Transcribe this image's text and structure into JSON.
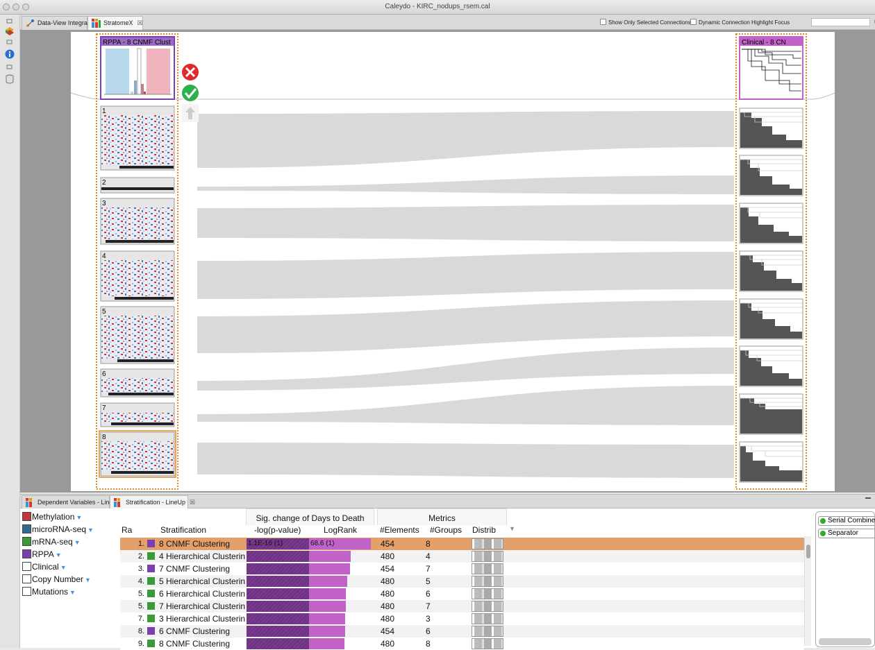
{
  "window": {
    "title": "Caleydo - KIRC_nodups_rsem.cal"
  },
  "tabs": [
    {
      "label": "Data-View Integrator",
      "active": false
    },
    {
      "label": "StratomeX",
      "active": true,
      "close": "☒"
    }
  ],
  "options": {
    "show_selected": "Show Only Selected Connections",
    "dynamic_highlight": "Dynamic Connection Highlight Focus",
    "help": "?"
  },
  "stratomex": {
    "left_column": {
      "title": "RPPA - 8 CNMF Clust",
      "groups": [
        "1",
        "2",
        "3",
        "4",
        "5",
        "6",
        "7",
        "8"
      ]
    },
    "right_column": {
      "title": "Clinical - 8 CN"
    }
  },
  "bottom_tabs": [
    {
      "label": "Dependent Variables - LineUp",
      "active": false
    },
    {
      "label": "Stratification - LineUp",
      "active": true,
      "close": "☒"
    }
  ],
  "filters": [
    {
      "label": "Methylation",
      "color": "#c0393b",
      "funnel": true
    },
    {
      "label": "microRNA-seq",
      "color": "#2f6d8f",
      "funnel": true
    },
    {
      "label": "mRNA-seq",
      "color": "#3a9a3a",
      "funnel": true
    },
    {
      "label": "RPPA",
      "color": "#7b3fb0",
      "funnel": true
    },
    {
      "label": "Clinical",
      "color": "#ffffff",
      "funnel": true
    },
    {
      "label": "Copy Number",
      "color": "#ffffff",
      "funnel": true
    },
    {
      "label": "Mutations",
      "color": "#ffffff",
      "funnel": true
    }
  ],
  "lineup": {
    "group_headers": {
      "sig": "Sig. change of Days to Death",
      "metrics": "Metrics"
    },
    "columns": {
      "rank": "Ra",
      "stratification": "Stratification",
      "pvalue": "-log(p-value)",
      "logrank": "LogRank",
      "elements": "#Elements",
      "groups": "#Groups",
      "distrib": "Distrib"
    },
    "rows": [
      {
        "rank": "1.",
        "color": "#7b3fb0",
        "name": "8 CNMF Clustering",
        "pvalue_label": "1.1E-16 (1)",
        "logrank_label": "68.6 (1)",
        "pvalue": 1.0,
        "logrank": 1.0,
        "elements": "454",
        "groups": "8",
        "selected": true
      },
      {
        "rank": "2.",
        "color": "#3a9a3a",
        "name": "4 Hierarchical Clusterin",
        "pvalue_label": "",
        "logrank_label": "",
        "pvalue": 1.0,
        "logrank": 0.67,
        "elements": "480",
        "groups": "4",
        "selected": false
      },
      {
        "rank": "3.",
        "color": "#7b3fb0",
        "name": "7 CNMF Clustering",
        "pvalue_label": "",
        "logrank_label": "",
        "pvalue": 1.0,
        "logrank": 0.66,
        "elements": "454",
        "groups": "7",
        "selected": false
      },
      {
        "rank": "4.",
        "color": "#3a9a3a",
        "name": "5 Hierarchical Clusterin",
        "pvalue_label": "",
        "logrank_label": "",
        "pvalue": 1.0,
        "logrank": 0.62,
        "elements": "480",
        "groups": "5",
        "selected": false
      },
      {
        "rank": "5.",
        "color": "#3a9a3a",
        "name": "6 Hierarchical Clusterin",
        "pvalue_label": "",
        "logrank_label": "",
        "pvalue": 1.0,
        "logrank": 0.6,
        "elements": "480",
        "groups": "6",
        "selected": false
      },
      {
        "rank": "5.",
        "color": "#3a9a3a",
        "name": "7 Hierarchical Clusterin",
        "pvalue_label": "",
        "logrank_label": "",
        "pvalue": 1.0,
        "logrank": 0.6,
        "elements": "480",
        "groups": "7",
        "selected": false
      },
      {
        "rank": "7.",
        "color": "#3a9a3a",
        "name": "3 Hierarchical Clusterin",
        "pvalue_label": "",
        "logrank_label": "",
        "pvalue": 1.0,
        "logrank": 0.58,
        "elements": "480",
        "groups": "3",
        "selected": false
      },
      {
        "rank": "8.",
        "color": "#7b3fb0",
        "name": "6 CNMF Clustering",
        "pvalue_label": "",
        "logrank_label": "",
        "pvalue": 1.0,
        "logrank": 0.58,
        "elements": "454",
        "groups": "6",
        "selected": false
      },
      {
        "rank": "9.",
        "color": "#3a9a3a",
        "name": "8 CNMF Clustering",
        "pvalue_label": "",
        "logrank_label": "",
        "pvalue": 1.0,
        "logrank": 0.57,
        "elements": "480",
        "groups": "8",
        "selected": false
      }
    ]
  },
  "side_panel": {
    "items": [
      "Serial Combiner",
      "Separator"
    ]
  }
}
